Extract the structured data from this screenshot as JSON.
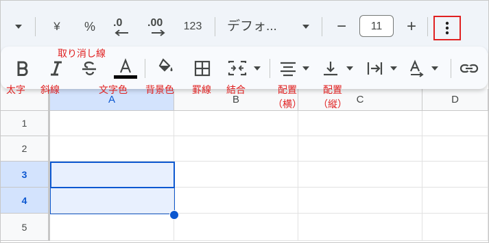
{
  "toolbar": {
    "currency_label": "¥",
    "percent_label": "%",
    "decimal_decrease_label": ".0",
    "decimal_increase_label": ".00",
    "number_format_label": "123",
    "font_family_value": "デフォ...",
    "font_size_value": "11",
    "minus_label": "−",
    "plus_label": "+"
  },
  "annotations": {
    "strikethrough": "取り消し線",
    "bold": "太字",
    "italic": "斜線",
    "text_color": "文字色",
    "fill_color": "背景色",
    "borders": "罫線",
    "merge": "結合",
    "h_align_1": "配置",
    "h_align_2": "（横）",
    "v_align_1": "配置",
    "v_align_2": "（縦）"
  },
  "grid": {
    "columns": [
      "A",
      "B",
      "C",
      "D"
    ],
    "rows": [
      "1",
      "2",
      "3",
      "4",
      "5"
    ]
  },
  "colors": {
    "accent": "#0b57d0",
    "highlight_box": "#e02020",
    "selection_fill": "#e8f0fe"
  }
}
